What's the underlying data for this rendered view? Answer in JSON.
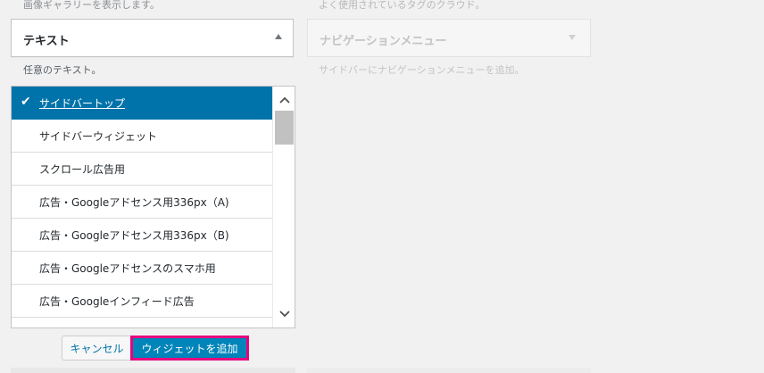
{
  "left_widget": {
    "top_description": "画像ギャラリーを表示します。",
    "title": "テキスト",
    "description": "任意のテキスト。"
  },
  "right_widget": {
    "top_description": "よく使用されているタグのクラウド。",
    "title": "ナビゲーションメニュー",
    "description": "サイドバーにナビゲーションメニューを追加。"
  },
  "chooser": {
    "items": [
      {
        "label": "サイドバートップ",
        "selected": true
      },
      {
        "label": "サイドバーウィジェット"
      },
      {
        "label": "スクロール広告用"
      },
      {
        "label": "広告・Googleアドセンス用336px（A)"
      },
      {
        "label": "広告・Googleアドセンス用336px（B)"
      },
      {
        "label": "広告・Googleアドセンスのスマホ用"
      },
      {
        "label": "広告・Googleインフィード広告"
      },
      {
        "label": ""
      }
    ]
  },
  "actions": {
    "cancel_label": "キャンセル",
    "add_label": "ウィジェットを追加"
  },
  "colors": {
    "selected_bg": "#0073aa",
    "primary_button": "#0085ba",
    "highlight_border": "#e6007e"
  }
}
